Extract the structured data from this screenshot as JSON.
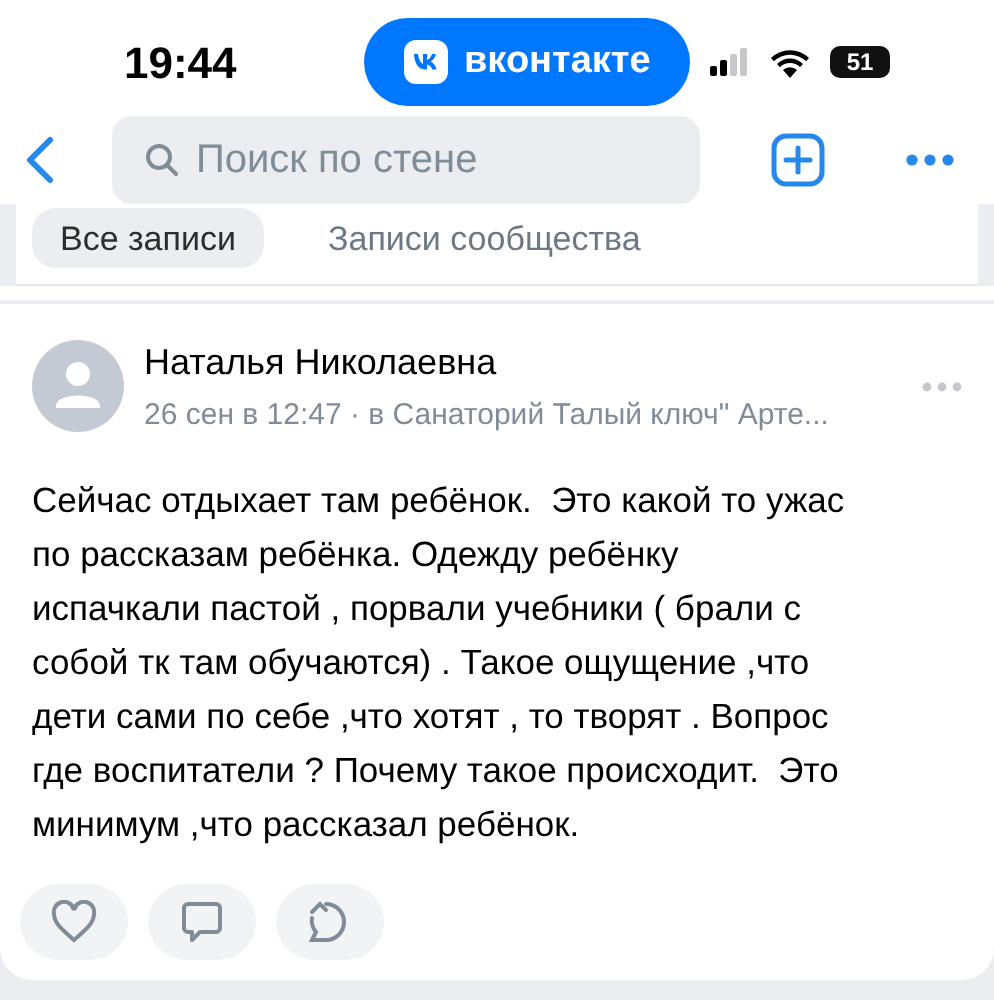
{
  "status_bar": {
    "time": "19:44",
    "app_pill": "вконтакте",
    "battery": "51"
  },
  "nav": {
    "search": {
      "placeholder": "Поиск по стене"
    }
  },
  "tabs": [
    {
      "label": "Все записи",
      "selected": true
    },
    {
      "label": "Записи сообщества",
      "selected": false
    }
  ],
  "post": {
    "author": "Наталья Николаевна",
    "meta": "26 сен в 12:47 · в Санаторий Талый ключ\" Арте...",
    "text_lines": [
      "Сейчас отдыхает там ребёнок.  Это какой то ужас",
      "по рассказам ребёнка. Одежду ребёнку",
      "испачкали пастой , порвали учебники ( брали с",
      "собой тк там обучаются) . Такое ощущение ,что",
      "дети сами по себе ,что хотят , то творят . Вопрос",
      "где воспитатели ? Почему такое происходит.  Это",
      "минимум ,что рассказал ребёнок."
    ],
    "actions": [
      {
        "kind": "like"
      },
      {
        "kind": "comment"
      },
      {
        "kind": "share"
      }
    ]
  }
}
